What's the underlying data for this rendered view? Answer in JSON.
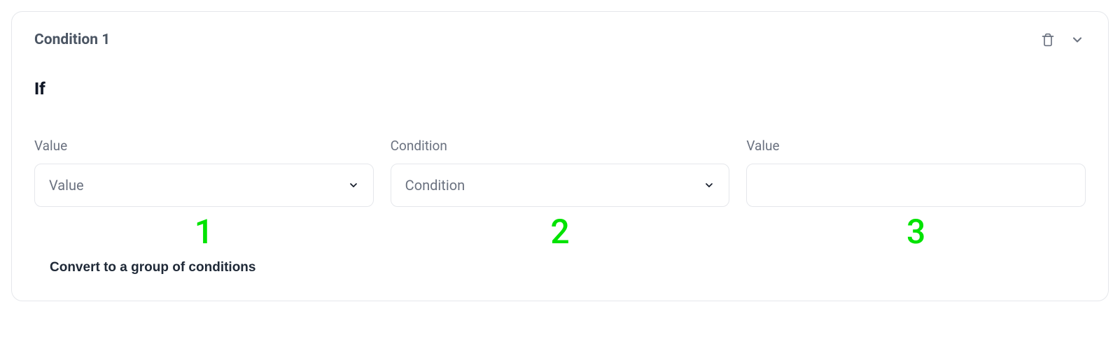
{
  "card": {
    "title": "Condition 1",
    "if_label": "If",
    "convert_label": "Convert to a group of conditions"
  },
  "fields": {
    "value1": {
      "label": "Value",
      "placeholder": "Value"
    },
    "condition": {
      "label": "Condition",
      "placeholder": "Condition"
    },
    "value2": {
      "label": "Value",
      "value": ""
    }
  },
  "annotations": {
    "col1": "1",
    "col2": "2",
    "col3": "3"
  },
  "colors": {
    "annotation": "#00e300",
    "border": "#e5e7eb",
    "text_muted": "#6b7280",
    "text_strong": "#111827"
  }
}
